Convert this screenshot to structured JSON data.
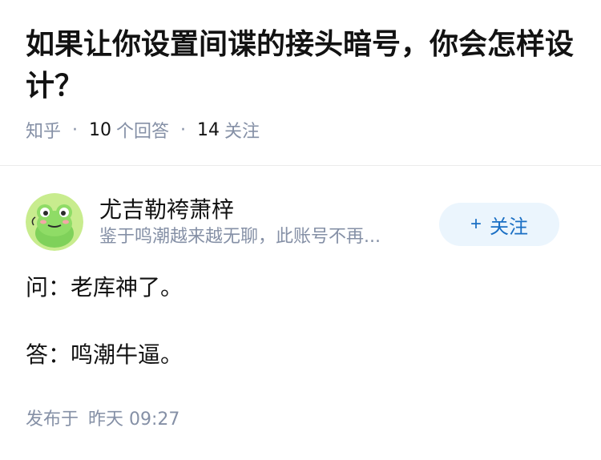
{
  "question": {
    "title": "如果让你设置间谍的接头暗号，你会怎样设计？",
    "source": "知乎",
    "answer_count": "10",
    "answer_label": "个回答",
    "follow_count": "14",
    "follow_label": "关注"
  },
  "author": {
    "name": "尤吉勒袴萧梓",
    "bio": "鉴于鸣潮越来越无聊，此账号不再...",
    "follow_button": "关注",
    "follow_icon": "plus-icon",
    "avatar_icon": "frog-avatar"
  },
  "answer": {
    "line1": "问：老库神了。",
    "line2": "答：鸣潮牛逼。"
  },
  "footer": {
    "published_label": "发布于",
    "published_time": "昨天 09:27"
  },
  "colors": {
    "accent": "#1a6fc4",
    "button_bg": "#ebf5fd",
    "muted": "#8590a6",
    "text": "#121212"
  }
}
